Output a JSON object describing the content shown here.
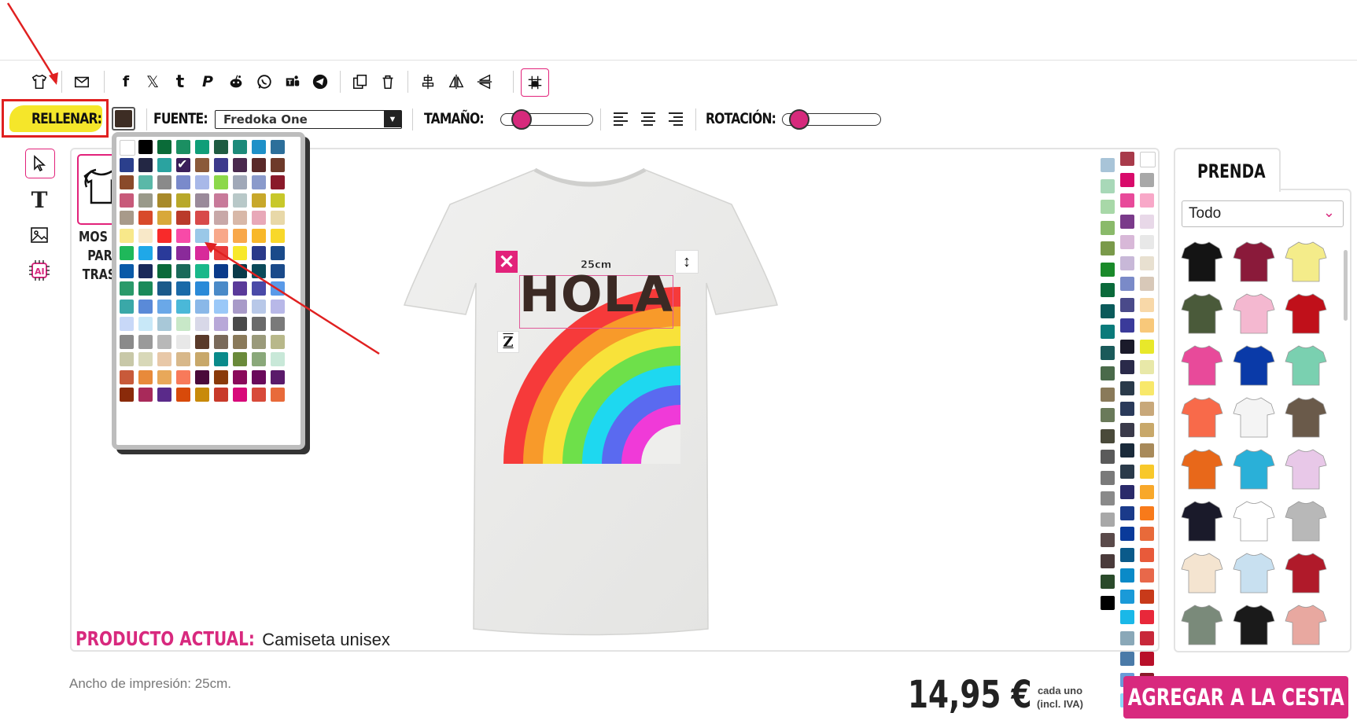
{
  "toolbar": {
    "icons": [
      "tshirt-icon",
      "mail-icon",
      "facebook-icon",
      "x-icon",
      "tumblr-icon",
      "pinterest-icon",
      "reddit-icon",
      "whatsapp-icon",
      "teams-icon",
      "telegram-icon",
      "duplicate-icon",
      "trash-icon",
      "align-center-icon",
      "flip-horizontal-icon",
      "flip-vertical-icon",
      "grid-icon"
    ]
  },
  "format_bar": {
    "fill_label": "RELLENAR:",
    "fill_color": "#3d2d24",
    "font_label": "FUENTE:",
    "font_value": "Fredoka One",
    "size_label": "TAMAÑO:",
    "size_value": 0.09,
    "rotation_label": "ROTACIÓN:",
    "rotation_value": 0.05
  },
  "left_tools": [
    "select-icon",
    "text-icon",
    "image-icon",
    "ai-icon"
  ],
  "canvas": {
    "back_button_text": "MOSTRAR PARTE TRASERA",
    "back_visible": [
      "MOS",
      "PAR",
      "TRAS"
    ],
    "text_object": "HOLA",
    "dimension_label": "25cm",
    "current_product_label": "PRODUCTO ACTUAL:",
    "current_product_value": "Camiseta unisex"
  },
  "palette_colors": [
    "#ffffff",
    "#000000",
    "#0a6b38",
    "#1b8f62",
    "#0f9e78",
    "#1f5c42",
    "#1c8a7a",
    "#1e90c8",
    "#2c6f9a",
    "#2b3f8c",
    "#232744",
    "#2aa3a0",
    "#3b1f5a",
    "#8a5a3a",
    "#3c3a8c",
    "#4a2a4e",
    "#5a2a2a",
    "#6e3a2a",
    "#8a4a2a",
    "#5ab8a8",
    "#8a8a8a",
    "#7a8acb",
    "#a8b8e8",
    "#8cd84a",
    "#a0a8b8",
    "#8a9acb",
    "#8a1a2a",
    "#c85a7a",
    "#9a9a8a",
    "#a88a2a",
    "#b8a82a",
    "#9a8a9a",
    "#c87a9a",
    "#b8c8c8",
    "#c8a82a",
    "#c8c82a",
    "#a89a8a",
    "#d84a2a",
    "#d8a83a",
    "#ba3a2a",
    "#d84a4a",
    "#c8a8a8",
    "#d8b8a8",
    "#e8a8b8",
    "#e8d8a8",
    "#f8e88a",
    "#f8e8c8",
    "#f82a2a",
    "#f84aa8",
    "#9ac8e8",
    "#f8a88a",
    "#f8a84a",
    "#f8b82a",
    "#f8d82a",
    "#1fb85a",
    "#1fa8e8",
    "#2a3a9a",
    "#8a2a9a",
    "#d82a9a",
    "#e83a3a",
    "#f8e82a",
    "#2a3a8a",
    "#1a4a8a",
    "#0a5aa8",
    "#1a2a5a",
    "#0a6a3a",
    "#1a6a5a",
    "#1ab88a",
    "#0a3a8a",
    "#0a3a4a",
    "#0a4a5a",
    "#1a4a8a",
    "#2a9a6a",
    "#1a8a5a",
    "#1a5a8a",
    "#1a6aa8",
    "#2a8ad8",
    "#4a8ac8",
    "#5a3a9a",
    "#4a4aa8",
    "#5a9ae8",
    "#3aa8a8",
    "#5a8ad8",
    "#6aa8e8",
    "#4ab8d8",
    "#8ab8e8",
    "#9ac8f8",
    "#a89ac8",
    "#b8c8e8",
    "#b8b8e8",
    "#c8d8f8",
    "#c8e8f8",
    "#a8c8d8",
    "#c8e8c8",
    "#d8d8e8",
    "#b8a8d8",
    "#4a4a4a",
    "#6a6a6a",
    "#7a7a7a",
    "#8a8a8a",
    "#9a9a9a",
    "#b8b8b8",
    "#e8e8e8",
    "#5a3a2a",
    "#7a6a5a",
    "#8a7a5a",
    "#9a9a7a",
    "#b8b88a",
    "#c8c8a8",
    "#d8d8b8",
    "#e8c8a8",
    "#d8b88a",
    "#c8a86a",
    "#0a8a8a",
    "#6a8a3a",
    "#8aa87a",
    "#c8e8d8",
    "#c85a3a",
    "#e88a3a",
    "#e8a85a",
    "#f87a5a",
    "#4a0a3a",
    "#8a3a0a",
    "#8a0a5a",
    "#6a0a5a",
    "#5a1a6a",
    "#8a2a0a",
    "#a82a5a",
    "#5a2a8a",
    "#d84a0a",
    "#c88a0a",
    "#c83a2a",
    "#d80a7a",
    "#d84a3a",
    "#e86a3a",
    "#d88ab8",
    "#d83a3a",
    "#f8b8a8",
    "#e84a5a",
    "#f8d8a8",
    "#f87a4a",
    "#f88a3a",
    "#f8c8b8",
    "#f8b8a8",
    "#f8c8d8",
    "#f8d8b8",
    "#f8a8a8",
    "#f8a82a",
    "#f8d8c8",
    "#f8e8a8",
    "#f8a8f8",
    "#f8f8f8",
    "#f8a82a",
    "#f8c8e8",
    "#f8d8b8",
    "#f8e8d8",
    "#f8f8c8",
    "#f8e8a8",
    "#f8f8a8"
  ],
  "right_colors": {
    "col1": [
      "#a8c4d8",
      "#a8d8b8",
      "#a8d8a8",
      "#8aba6a",
      "#7a9a4a",
      "#1a8a2a",
      "#0a6a3a",
      "#0a5a5a",
      "#0a7a7a",
      "#1a5a5a",
      "#4a6a4a",
      "#8a7a5a",
      "#6a7a5a",
      "#4a4a3a",
      "#5a5a5a",
      "#7a7a7a",
      "#8a8a8a",
      "#a8a8a8",
      "#5a4a4a",
      "#4a3a3a",
      "#2a4a2a",
      "#000000"
    ],
    "col2": [
      "#a83a4a",
      "#d80a6a",
      "#e84a9a",
      "#7a3a8a",
      "#d8b8d8",
      "#c8b8d8",
      "#7a8ac8",
      "#4a4a8a",
      "#3a3a9a",
      "#1a1a2a",
      "#2a2a4a",
      "#2a3a4a",
      "#2a3a5a",
      "#3a3a4a",
      "#1a2a3a",
      "#2a3a4a",
      "#2a2a6a",
      "#1a3a8a",
      "#0a3a9a",
      "#0a5a8a",
      "#0a8ac8",
      "#1a9ad8",
      "#1ab8e8",
      "#8aa8b8",
      "#4a7aa8",
      "#6a9ad8",
      "#8ad8f8"
    ],
    "col3": [
      "#ffffff",
      "#a8a8a8",
      "#f8a8c8",
      "#e8d8e8",
      "#e8e8e8",
      "#e8e0d0",
      "#d8c8b8",
      "#f8d8a8",
      "#f8c87a",
      "#e8e82a",
      "#e8e8a8",
      "#f8e86a",
      "#c8a87a",
      "#c8a86a",
      "#a88a5a",
      "#f8c82a",
      "#f8a82a",
      "#f87a1a",
      "#e86a3a",
      "#e85a3a",
      "#e8684a",
      "#c83a1a",
      "#e8283a",
      "#c8283a",
      "#b8102a",
      "#8a1a2a",
      "#6a1a2a"
    ]
  },
  "product_panel": {
    "tab_label": "PRENDA",
    "filter_value": "Todo",
    "items": [
      "black-tshirt",
      "maroon-tshirt",
      "yellow-tshirt",
      "olive-tshirt",
      "pink-tshirt",
      "red-tshirt",
      "magenta-tshirt",
      "blue-tshirt",
      "mint-tshirt",
      "coral-tshirt",
      "white-tanktop",
      "brown-tanktop",
      "orange-hoodie",
      "cyan-hoodie",
      "tiedye-tshirt",
      "black-tshirt-2",
      "raglan-tshirt",
      "gray-hoodie",
      "cream-tshirt",
      "gradient-tshirt",
      "varsity-jacket",
      "sage-longsleeve",
      "black-orange-hoodie",
      "peach-tanktop"
    ]
  },
  "footer": {
    "print_width": "Ancho de impresión: 25cm.",
    "price": "14,95 €",
    "per_unit_1": "cada uno",
    "per_unit_2": "(incl. IVA)",
    "add_to_cart": "AGREGAR A LA CESTA"
  }
}
